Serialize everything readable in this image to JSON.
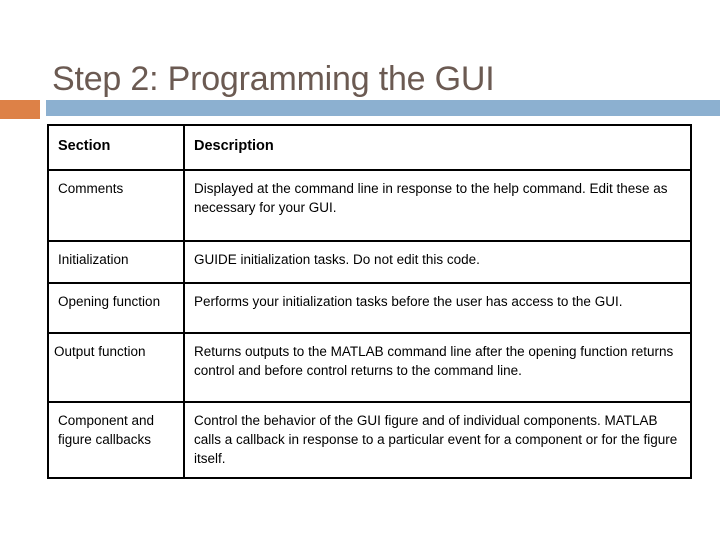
{
  "slide": {
    "title": "Step 2: Programming the GUI",
    "accent_orange": "#dd8147",
    "accent_blue": "#8cb0d0",
    "title_color": "#6b5a52"
  },
  "table": {
    "headers": {
      "section": "Section",
      "description": "Description"
    },
    "rows": [
      {
        "section": "Comments",
        "description": "Displayed at the command line in response to the help command. Edit these as necessary for your GUI."
      },
      {
        "section": "Initialization",
        "description": "GUIDE initialization tasks. Do not edit this code."
      },
      {
        "section": "Opening function",
        "description": "Performs your initialization tasks before the user has access to the GUI."
      },
      {
        "section": "Output function",
        "description": "Returns outputs to the MATLAB command line after the opening function returns control and before control returns to the command line."
      },
      {
        "section": "Component and figure callbacks",
        "description": "Control the behavior of the GUI figure and of individual components. MATLAB calls a callback in response to a particular event for a component or for the figure itself."
      }
    ]
  }
}
